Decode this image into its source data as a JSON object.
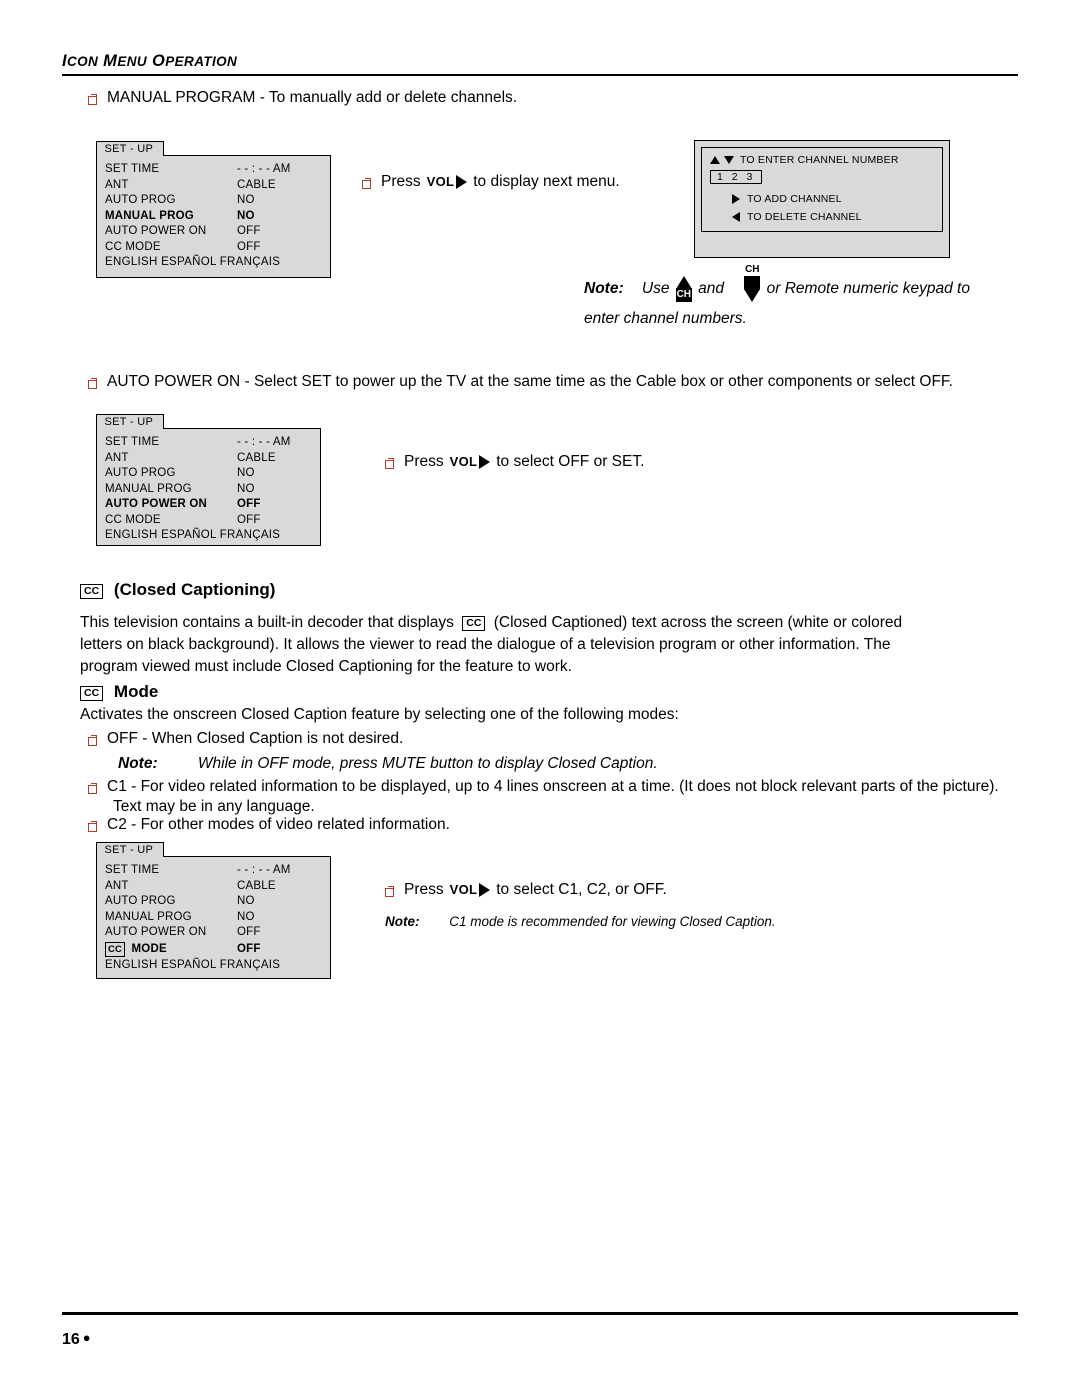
{
  "header": {
    "title_caps": "I",
    "title": "ICON MENU OPERATION"
  },
  "sections": {
    "manual_program": {
      "bullet_text": "MANUAL PROGRAM - To manually add or delete channels.",
      "press_prefix": "Press",
      "vol_label": "VOL",
      "press_suffix": "to display next menu.",
      "menu": {
        "tab": "SET - UP",
        "rows": [
          {
            "label": "SET TIME",
            "value": "- - : - -  AM",
            "highlight": false
          },
          {
            "label": "ANT",
            "value": "CABLE",
            "highlight": false
          },
          {
            "label": "AUTO PROG",
            "value": "NO",
            "highlight": false
          },
          {
            "label": "MANUAL PROG",
            "value": "NO",
            "highlight": true
          },
          {
            "label": "AUTO POWER ON",
            "value": "OFF",
            "highlight": false
          },
          {
            "label": "CC MODE",
            "value": "OFF",
            "highlight": false
          }
        ],
        "languages": "ENGLISH  ESPAÑOL  FRANÇAIS"
      },
      "channel_osd": {
        "enter_line": "TO ENTER CHANNEL NUMBER",
        "digits": "1  2  3",
        "add_line": "TO ADD CHANNEL",
        "delete_line": "TO DELETE CHANNEL"
      },
      "note": {
        "label": "Note:",
        "part1": "Use",
        "ch_up": "CH",
        "part2": "and",
        "ch_down": "CH",
        "part3": "or Remote numeric keypad to",
        "line2": "enter channel numbers."
      }
    },
    "auto_power_on": {
      "bullet_text": "AUTO POWER ON - Select SET to power up the TV at the same time as the Cable box or other components or select OFF.",
      "press_prefix": "Press",
      "vol_label": "VOL",
      "press_suffix": "to select OFF or SET.",
      "menu": {
        "tab": "SET - UP",
        "rows": [
          {
            "label": "SET TIME",
            "value": "- - : - -  AM",
            "highlight": false
          },
          {
            "label": "ANT",
            "value": "CABLE",
            "highlight": false
          },
          {
            "label": "AUTO PROG",
            "value": "NO",
            "highlight": false
          },
          {
            "label": "MANUAL PROG",
            "value": "NO",
            "highlight": false
          },
          {
            "label": "AUTO POWER ON",
            "value": "OFF",
            "highlight": true
          },
          {
            "label": "CC  MODE",
            "value": "OFF",
            "highlight": false
          }
        ],
        "languages": "ENGLISH  ESPAÑOL  FRANÇAIS"
      }
    },
    "closed_captioning": {
      "cc_badge": "CC",
      "heading": "(Closed Captioning)",
      "paragraph_a": "This television contains a built-in decoder that displays",
      "paragraph_b": "(Closed Captioned) text across the screen (white or colored",
      "paragraph_line2": "letters on black background). It allows the viewer to read the dialogue of a television program or other information. The",
      "paragraph_line3": "program viewed must include Closed Captioning for the feature to work."
    },
    "cc_mode": {
      "cc_badge": "CC",
      "heading": "Mode",
      "intro": "Activates the onscreen Closed Caption feature by selecting one of the following modes:",
      "items": [
        "OFF - When Closed Caption is not desired.",
        "C1 - For video related information to be displayed, up to 4 lines onscreen at a time. (It does not block relevant parts of the picture).",
        "C2 - For other modes of video related information."
      ],
      "item_c1_line2": "Text may be in any language.",
      "note_off": {
        "label": "Note:",
        "text": "While in OFF mode, press MUTE button to display Closed Caption."
      },
      "menu": {
        "tab": "SET - UP",
        "rows": [
          {
            "label": "SET TIME",
            "value": "- - : - -  AM",
            "highlight": false
          },
          {
            "label": "ANT",
            "value": "CABLE",
            "highlight": false
          },
          {
            "label": "AUTO PROG",
            "value": "NO",
            "highlight": false
          },
          {
            "label": "MANUAL PROG",
            "value": "NO",
            "highlight": false
          },
          {
            "label": "AUTO POWER ON",
            "value": "OFF",
            "highlight": false
          },
          {
            "label": "MODE",
            "value": "OFF",
            "highlight": true,
            "cc_badge": "CC"
          }
        ],
        "languages": "ENGLISH  ESPAÑOL  FRANÇAIS"
      },
      "press_prefix": "Press",
      "vol_label": "VOL",
      "press_suffix": "to select C1, C2, or OFF.",
      "note_c1": {
        "label": "Note:",
        "text": "C1 mode is recommended for viewing Closed Caption."
      }
    }
  },
  "footer": {
    "page_number": "16"
  }
}
